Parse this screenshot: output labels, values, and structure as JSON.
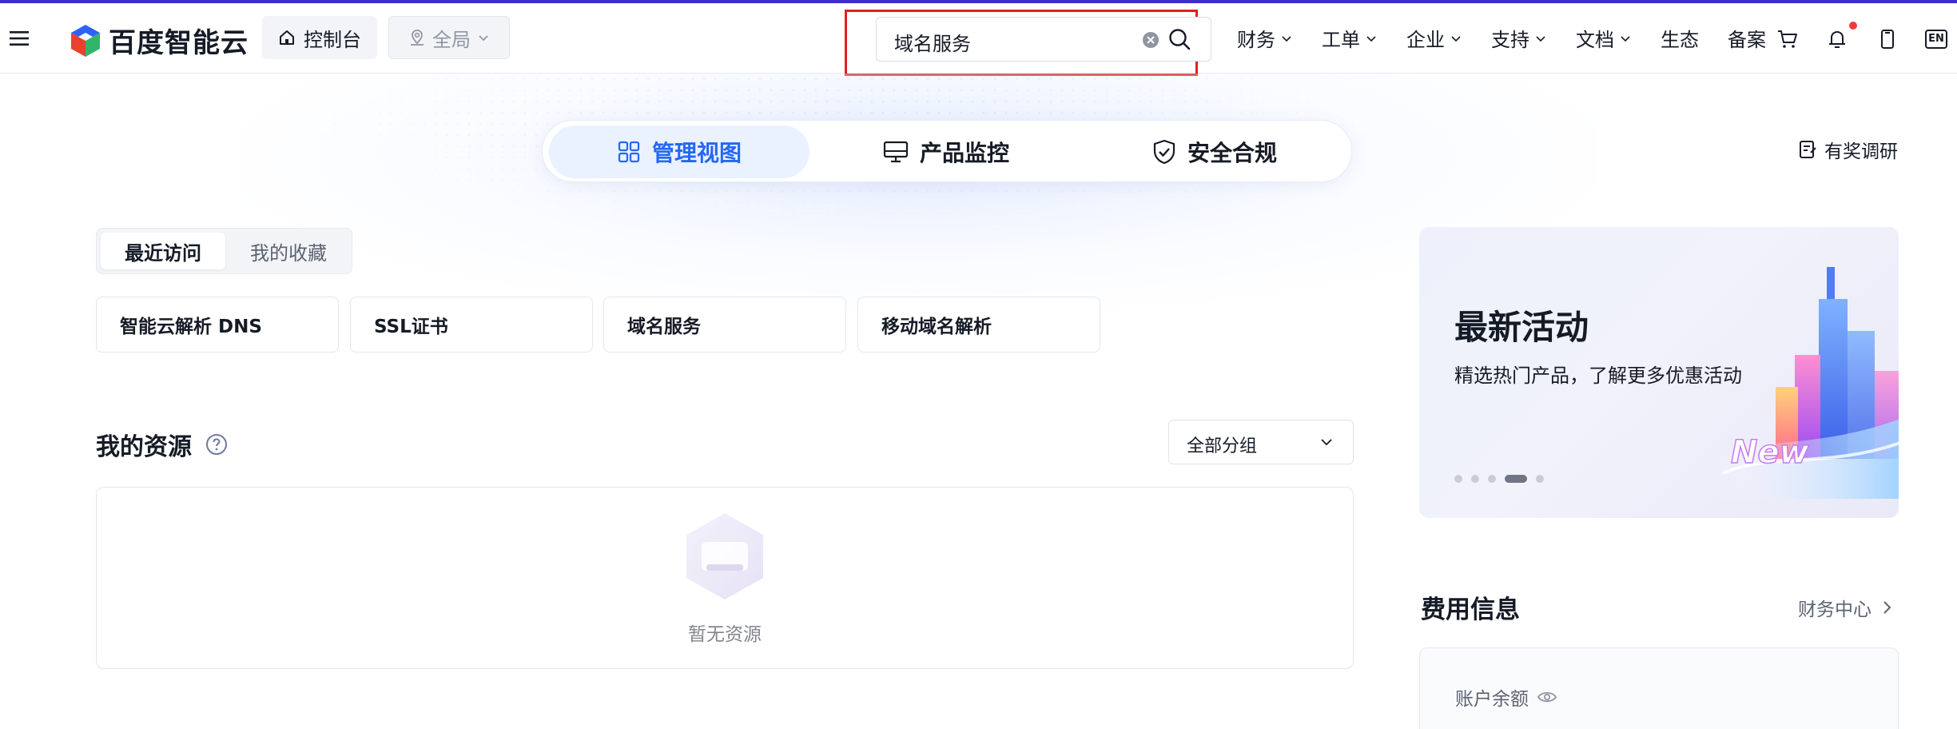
{
  "header": {
    "brand": "百度智能云",
    "console_label": "控制台",
    "region_label": "全局",
    "search": {
      "value": "域名服务"
    },
    "nav": [
      "财务",
      "工单",
      "企业",
      "支持",
      "文档",
      "生态",
      "备案"
    ],
    "lang": "EN"
  },
  "view_switch": {
    "tabs": [
      "管理视图",
      "产品监控",
      "安全合规"
    ],
    "active": "管理视图"
  },
  "survey_label": "有奖调研",
  "recent": {
    "tabs": [
      "最近访问",
      "我的收藏"
    ],
    "items": [
      "智能云解析 DNS",
      "SSL证书",
      "域名服务",
      "移动域名解析"
    ]
  },
  "resources": {
    "title": "我的资源",
    "group_select": "全部分组",
    "empty_text": "暂无资源"
  },
  "promo": {
    "title": "最新活动",
    "subtitle": "精选热门产品，了解更多优惠活动",
    "art_text": "New",
    "slide_count": 5,
    "active_slide": 4
  },
  "fees": {
    "title": "费用信息",
    "link": "财务中心",
    "balance_label": "账户余额"
  },
  "colors": {
    "accent": "#2468f2",
    "top_line": "#3d2cc7",
    "highlight": "#e02020",
    "notify_dot": "#f03c3c"
  }
}
